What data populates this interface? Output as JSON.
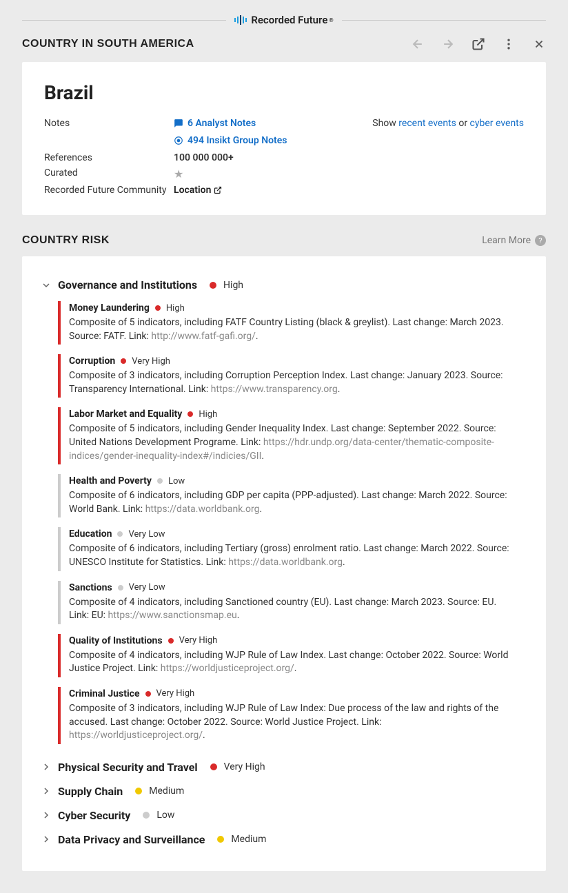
{
  "brand": "Recorded Future",
  "header": {
    "subtitle": "COUNTRY IN SOUTH AMERICA"
  },
  "country": {
    "name": "Brazil"
  },
  "meta": {
    "notes_label": "Notes",
    "analyst_notes": "6 Analyst Notes",
    "insikt_notes": "494 Insikt Group Notes",
    "references_label": "References",
    "references_value": "100 000 000+",
    "curated_label": "Curated",
    "community_label": "Recorded Future Community",
    "community_value": "Location"
  },
  "show_links": {
    "prefix": "Show ",
    "recent": "recent events",
    "or": " or ",
    "cyber": "cyber events"
  },
  "risk_section": {
    "title": "COUNTRY RISK",
    "learn_more": "Learn More"
  },
  "categories": [
    {
      "name": "Governance and Institutions",
      "level": "High",
      "level_class": "high",
      "expanded": true,
      "indicators": [
        {
          "name": "Money Laundering",
          "level": "High",
          "level_class": "high",
          "desc_pre": "Composite of 5 indicators, including FATF Country Listing (black & greylist). Last change: March 2023. Source: FATF. Link: ",
          "link": "http://www.fatf-gafi.org/",
          "desc_post": "."
        },
        {
          "name": "Corruption",
          "level": "Very High",
          "level_class": "very-high",
          "desc_pre": "Composite of 3 indicators, including Corruption Perception Index. Last change: January 2023. Source: Transparency International. Link: ",
          "link": "https://www.transparency.org",
          "desc_post": "."
        },
        {
          "name": "Labor Market and Equality",
          "level": "High",
          "level_class": "high",
          "desc_pre": "Composite of 5 indicators, including Gender Inequality Index. Last change: September 2022. Source: United Nations Development Programe. Link: ",
          "link": "https://hdr.undp.org/data-center/thematic-composite-indices/gender-inequality-index#/indicies/GII",
          "desc_post": "."
        },
        {
          "name": "Health and Poverty",
          "level": "Low",
          "level_class": "low",
          "desc_pre": "Composite of 6 indicators, including GDP per capita (PPP-adjusted). Last change: March 2022. Source: World Bank. Link: ",
          "link": "https://data.worldbank.org",
          "desc_post": "."
        },
        {
          "name": "Education",
          "level": "Very Low",
          "level_class": "very-low",
          "desc_pre": "Composite of 6 indicators, including Tertiary (gross) enrolment ratio. Last change: March 2022. Source: UNESCO Institute for Statistics. Link: ",
          "link": "https://data.worldbank.org",
          "desc_post": "."
        },
        {
          "name": "Sanctions",
          "level": "Very Low",
          "level_class": "very-low",
          "desc_pre": "Composite of 4 indicators, including Sanctioned country (EU). Last change: March 2023. Source: EU. Link: EU: ",
          "link": "https://www.sanctionsmap.eu",
          "desc_post": "."
        },
        {
          "name": "Quality of Institutions",
          "level": "Very High",
          "level_class": "very-high",
          "desc_pre": "Composite of 4 indicators, including WJP Rule of Law Index. Last change: October 2022. Source: World Justice Project. Link: ",
          "link": "https://worldjusticeproject.org/",
          "desc_post": "."
        },
        {
          "name": "Criminal Justice",
          "level": "Very High",
          "level_class": "very-high",
          "desc_pre": "Composite of 3 indicators, including WJP Rule of Law Index: Due process of the law and rights of the accused. Last change: October 2022. Source: World Justice Project. Link: ",
          "link": "https://worldjusticeproject.org/",
          "desc_post": "."
        }
      ]
    },
    {
      "name": "Physical Security and Travel",
      "level": "Very High",
      "level_class": "very-high",
      "expanded": false
    },
    {
      "name": "Supply Chain",
      "level": "Medium",
      "level_class": "medium",
      "expanded": false
    },
    {
      "name": "Cyber Security",
      "level": "Low",
      "level_class": "low",
      "expanded": false
    },
    {
      "name": "Data Privacy and Surveillance",
      "level": "Medium",
      "level_class": "medium",
      "expanded": false
    }
  ]
}
